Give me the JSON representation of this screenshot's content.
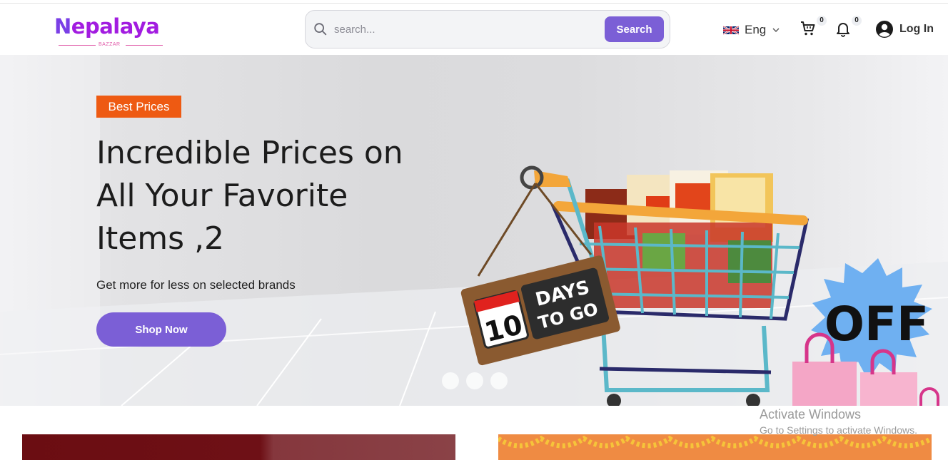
{
  "brand": {
    "name_first": "N",
    "name_rest": "epalaya",
    "subtitle": "BAZZAR"
  },
  "search": {
    "placeholder": "search...",
    "button_label": "Search"
  },
  "language": {
    "label": "Eng"
  },
  "cart": {
    "count": "0"
  },
  "notifications": {
    "count": "0"
  },
  "account": {
    "login_label": "Log In"
  },
  "hero": {
    "badge": "Best Prices",
    "title": "Incredible Prices on All Your Favorite Items ,2",
    "subtitle": "Get more for less on selected brands",
    "cta_label": "Shop Now",
    "tag_number": "10",
    "tag_line1": "DAYS",
    "tag_line2": "TO GO",
    "burst_text": "OFF",
    "slides": 3
  },
  "watermark": {
    "title": "Activate Windows",
    "subtitle": "Go to Settings to activate Windows."
  },
  "colors": {
    "accent": "#7b5fd6",
    "badge": "#ee5a12",
    "brand": "#a21ce0"
  },
  "icons": [
    "search-icon",
    "uk-flag-icon",
    "chevron-down-icon",
    "cart-icon",
    "bell-icon",
    "user-icon"
  ]
}
